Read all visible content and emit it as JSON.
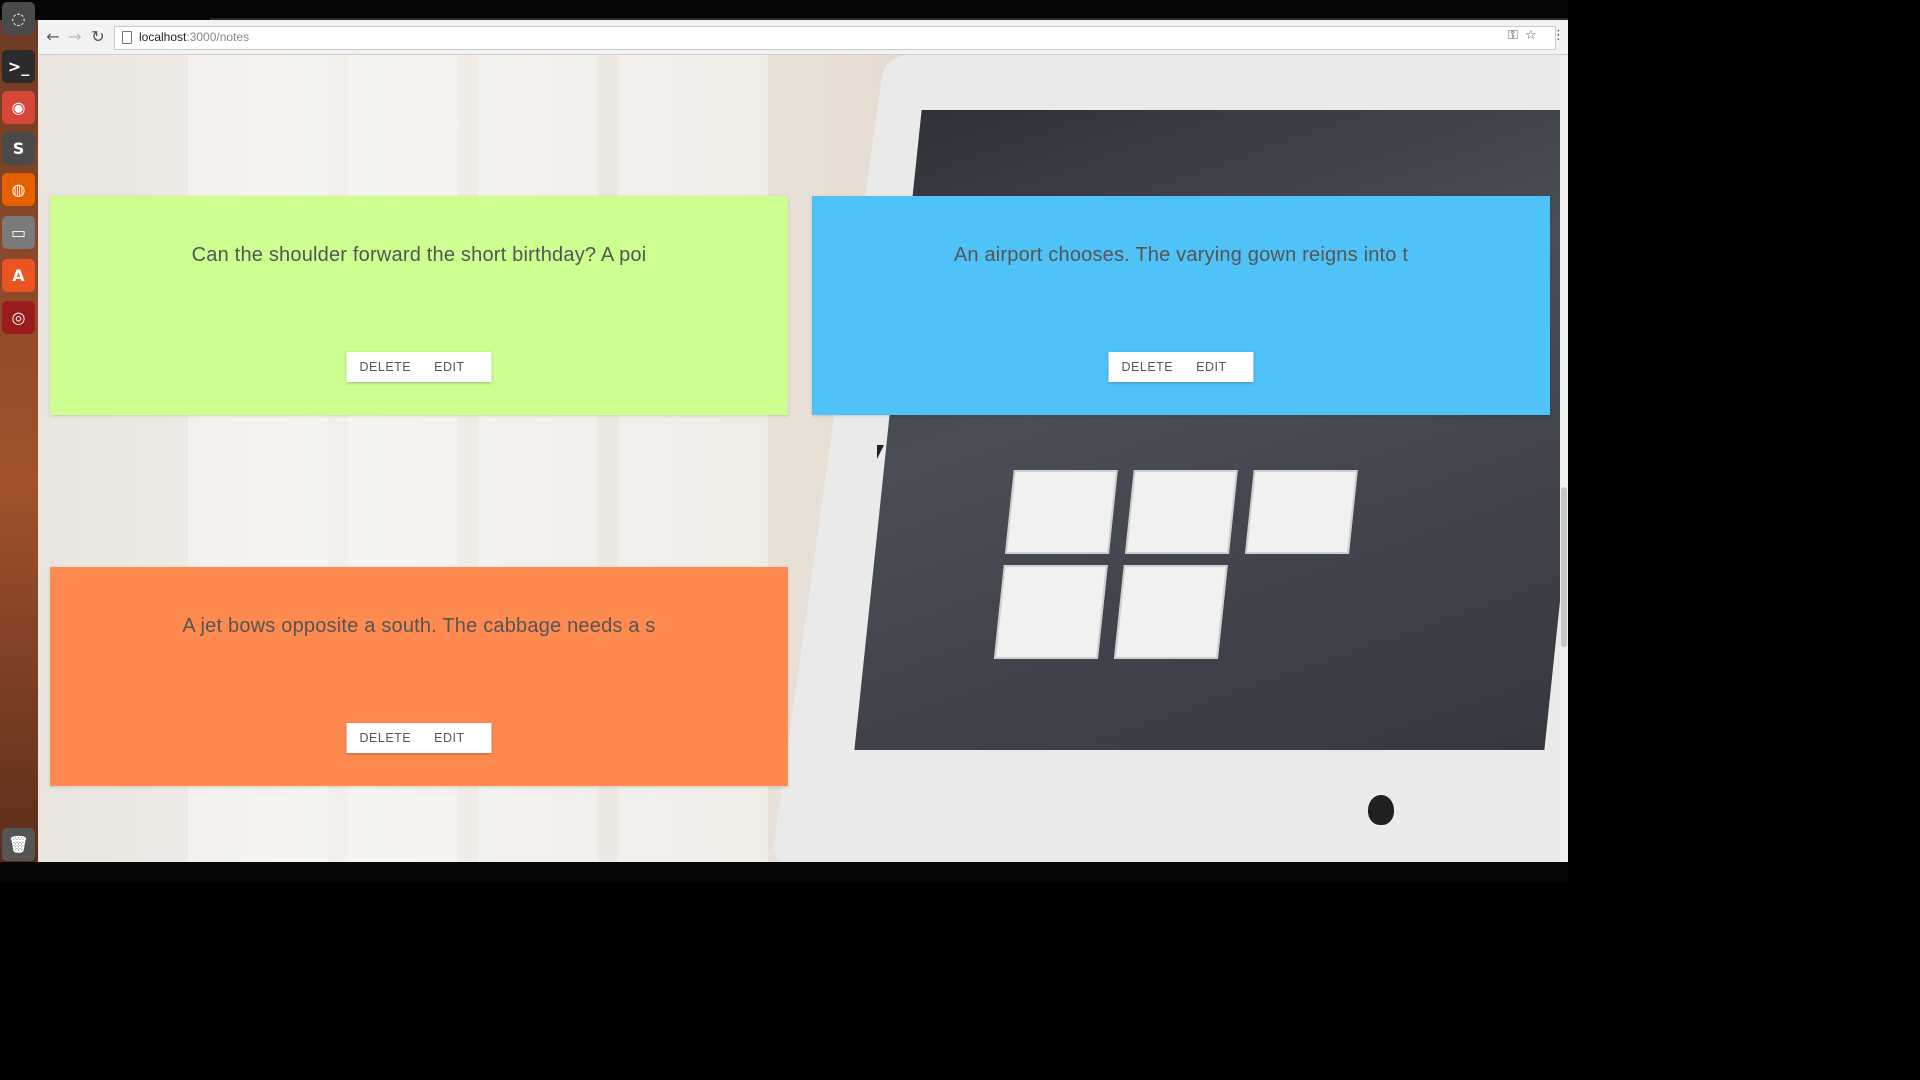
{
  "browser": {
    "url_host": "localhost",
    "url_path": ":3000/notes",
    "back_icon": "arrow-left-icon",
    "forward_icon": "arrow-right-icon",
    "reload_icon": "reload-icon",
    "key_icon": "key-icon",
    "star_icon": "star-icon",
    "menu_icon": "kebab-menu-icon"
  },
  "launcher": {
    "items": [
      {
        "name": "terminal",
        "glyph": ">_",
        "color": "#2b2b2b"
      },
      {
        "name": "chrome",
        "glyph": "◉",
        "color": "#d6473a"
      },
      {
        "name": "sublime-text",
        "glyph": "S",
        "color": "#4a4a4a"
      },
      {
        "name": "firefox",
        "glyph": "◍",
        "color": "#e66000"
      },
      {
        "name": "files",
        "glyph": "▭",
        "color": "#7a7a7a"
      },
      {
        "name": "software-center",
        "glyph": "A",
        "color": "#e95420"
      },
      {
        "name": "app",
        "glyph": "◎",
        "color": "#9b1c1c"
      },
      {
        "name": "trash",
        "glyph": "🗑",
        "color": "#555555"
      }
    ]
  },
  "notes": [
    {
      "text": "Can the shoulder forward the short birthday? A poi",
      "color": "#ccff90",
      "delete_label": "DELETE",
      "edit_label": "EDIT"
    },
    {
      "text": "An airport chooses. The varying gown reigns into t",
      "color": "#4fc3f7",
      "delete_label": "DELETE",
      "edit_label": "EDIT"
    },
    {
      "text": "A jet bows opposite a south. The cabbage needs a s",
      "color": "#ff8a50",
      "delete_label": "DELETE",
      "edit_label": "EDIT"
    }
  ]
}
